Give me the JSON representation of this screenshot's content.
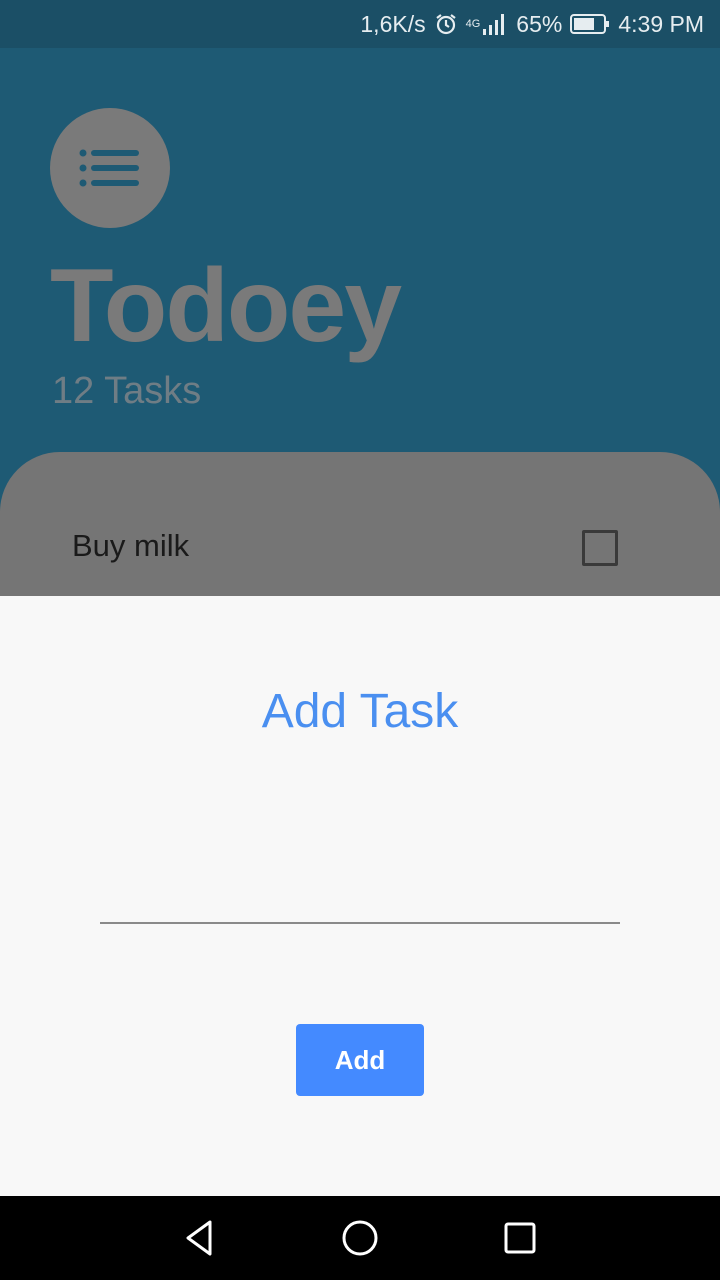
{
  "status_bar": {
    "network_speed": "1,6K/s",
    "signal_label": "4G",
    "battery_percent": "65%",
    "time": "4:39 PM",
    "icons": [
      "alarm-icon",
      "signal-icon",
      "battery-icon"
    ]
  },
  "header": {
    "menu_icon": "list-icon",
    "title": "Todoey",
    "task_count": "12 Tasks"
  },
  "task_list": {
    "items": [
      {
        "label": "Buy milk",
        "checked": false
      }
    ]
  },
  "add_task_sheet": {
    "title": "Add Task",
    "input_value": "",
    "add_button_label": "Add"
  },
  "colors": {
    "header_bg": "#1e5a74",
    "accent": "#448aff",
    "title_text": "#4a8ff0",
    "sheet_bg": "#f8f8f8"
  },
  "nav_bar": {
    "icons": [
      "back-icon",
      "home-icon",
      "recents-icon"
    ]
  }
}
